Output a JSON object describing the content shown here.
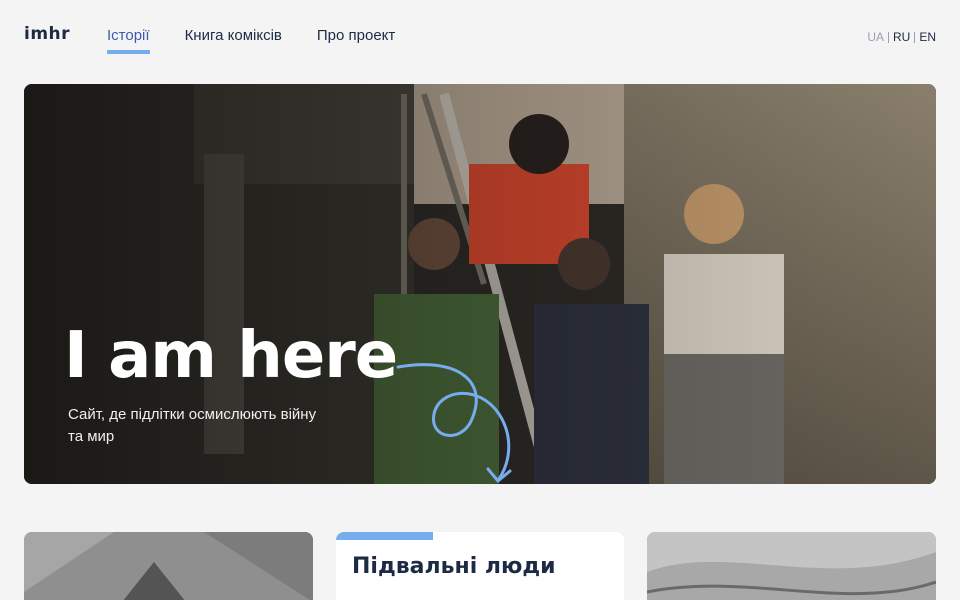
{
  "header": {
    "logo": "imhr",
    "nav": [
      {
        "label": "Історії",
        "active": true
      },
      {
        "label": "Книга коміксів",
        "active": false
      },
      {
        "label": "Про проект",
        "active": false
      }
    ],
    "languages": [
      "UA",
      "RU",
      "EN"
    ],
    "current_language": "RU"
  },
  "hero": {
    "title": "I am here",
    "subtitle": "Сайт, де підлітки осмислюють війну та мир"
  },
  "cards": [
    {
      "title": ""
    },
    {
      "title": "Підвальні люди"
    },
    {
      "title": ""
    }
  ],
  "colors": {
    "accent": "#77acef",
    "text": "#1d2a44",
    "background": "#f4f4f4"
  }
}
